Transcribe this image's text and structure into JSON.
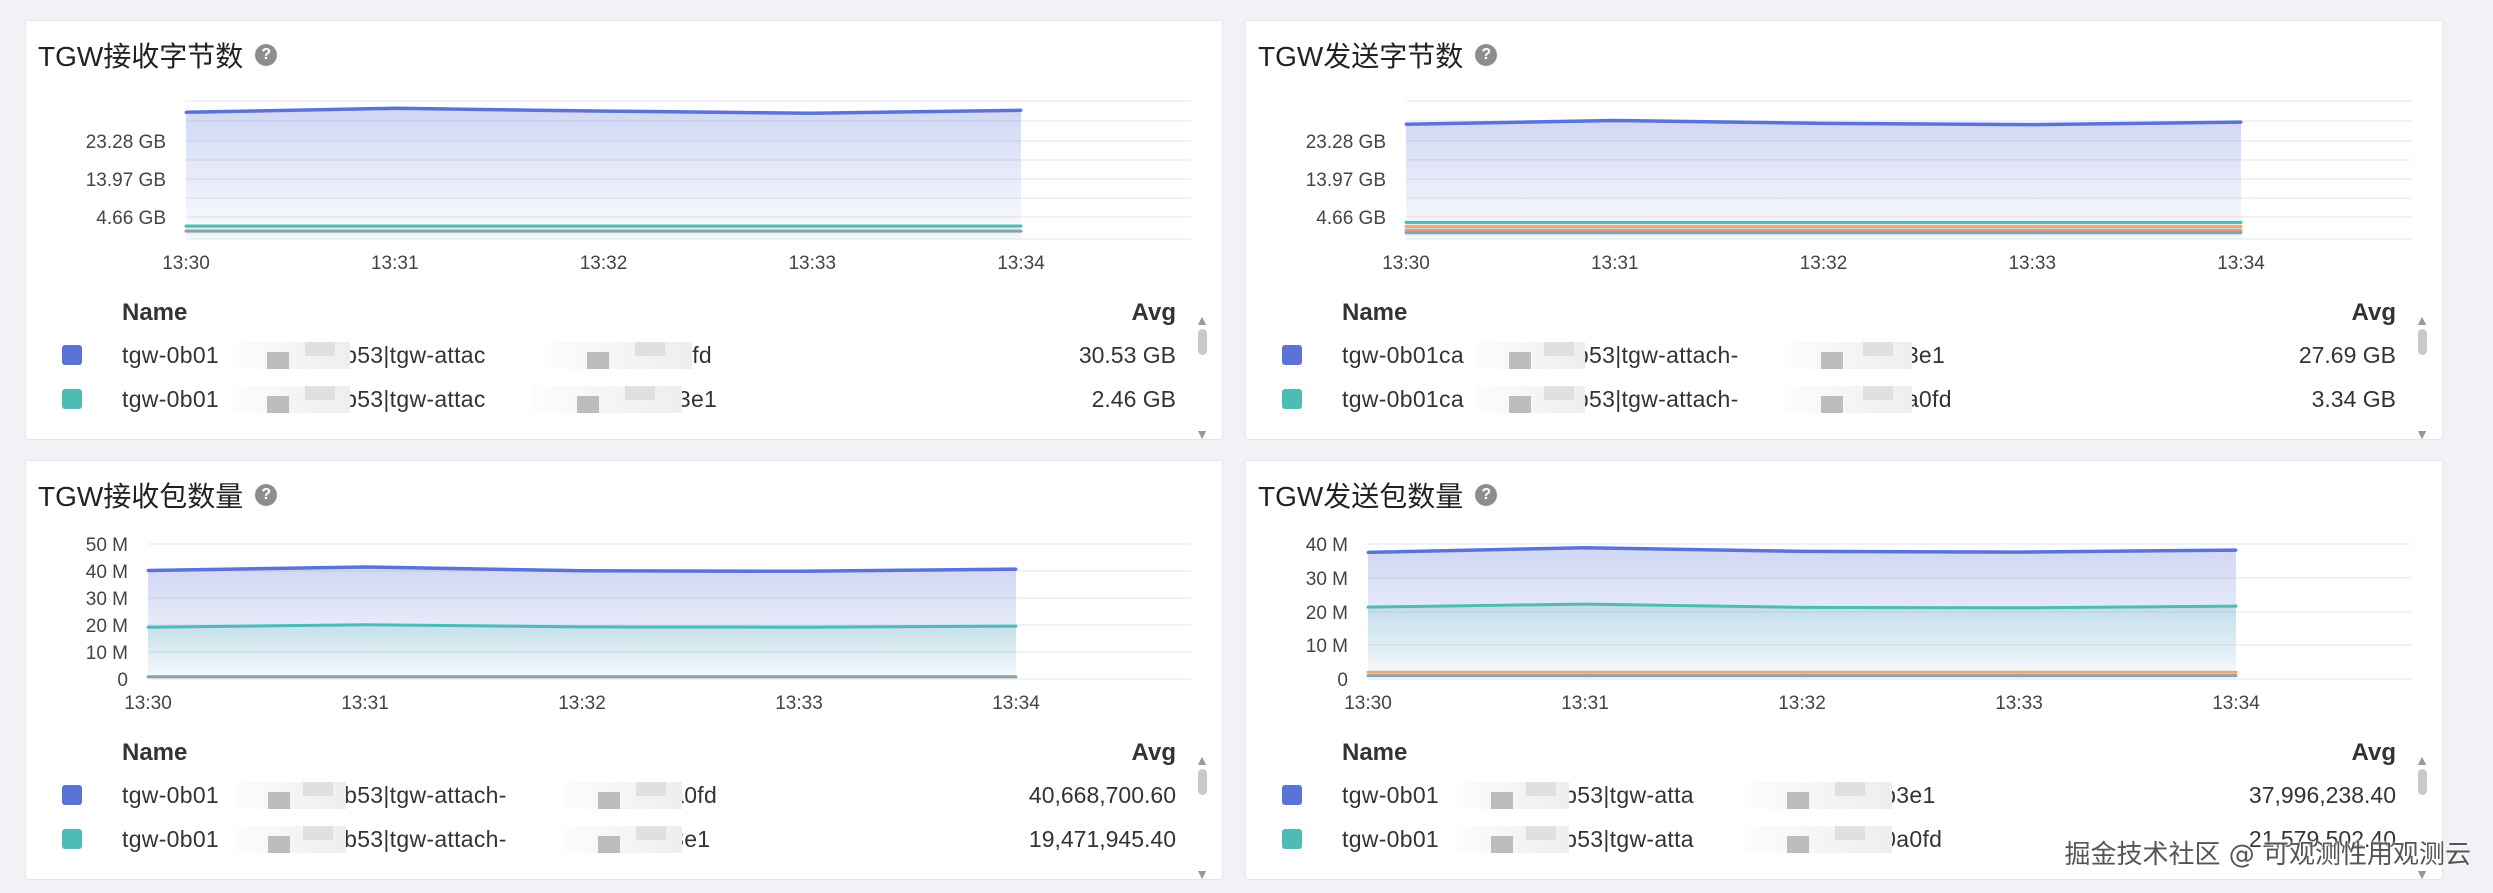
{
  "panels": [
    {
      "title": "TGW接收字节数",
      "y_ticks": [
        "23.28 GB",
        "13.97 GB",
        "4.66 GB"
      ],
      "x_ticks": [
        "13:30",
        "13:31",
        "13:32",
        "13:33",
        "13:34"
      ],
      "legend_header": {
        "name": "Name",
        "avg": "Avg"
      },
      "rows": [
        {
          "name": "tgw-0b01",
          "name_mid": "ab53|tgw-attac",
          "name_end": "8a20a0fd",
          "avg": "30.53 GB",
          "color": "#5b73d8"
        },
        {
          "name": "tgw-0b01",
          "name_mid": "ab53|tgw-attac",
          "name_end": "ca91b3e1",
          "avg": "2.46 GB",
          "color": "#4ebbb4"
        }
      ]
    },
    {
      "title": "TGW发送字节数",
      "y_ticks": [
        "23.28 GB",
        "13.97 GB",
        "4.66 GB"
      ],
      "x_ticks": [
        "13:30",
        "13:31",
        "13:32",
        "13:33",
        "13:34"
      ],
      "legend_header": {
        "name": "Name",
        "avg": "Avg"
      },
      "rows": [
        {
          "name": "tgw-0b01ca",
          "name_mid": "b53|tgw-attach-",
          "name_end": "91b3e1",
          "avg": "27.69 GB",
          "color": "#5b73d8"
        },
        {
          "name": "tgw-0b01ca",
          "name_mid": "b53|tgw-attach-",
          "name_end": "a20a0fd",
          "avg": "3.34 GB",
          "color": "#4ebbb4"
        }
      ]
    },
    {
      "title": "TGW接收包数量",
      "y_ticks": [
        "50 M",
        "40 M",
        "30 M",
        "20 M",
        "10 M",
        "0"
      ],
      "x_ticks": [
        "13:30",
        "13:31",
        "13:32",
        "13:33",
        "13:34"
      ],
      "legend_header": {
        "name": "Name",
        "avg": "Avg"
      },
      "rows": [
        {
          "name": "tgw-0b01",
          "name_mid": "ab53|tgw-attach-",
          "name_end": "8a20a0fd",
          "avg": "40,668,700.60",
          "color": "#5b73d8"
        },
        {
          "name": "tgw-0b01",
          "name_mid": "ab53|tgw-attach-",
          "name_end": "a91b3e1",
          "avg": "19,471,945.40",
          "color": "#4ebbb4"
        }
      ]
    },
    {
      "title": "TGW发送包数量",
      "y_ticks": [
        "40 M",
        "30 M",
        "20 M",
        "10 M",
        "0"
      ],
      "x_ticks": [
        "13:30",
        "13:31",
        "13:32",
        "13:33",
        "13:34"
      ],
      "legend_header": {
        "name": "Name",
        "avg": "Avg"
      },
      "rows": [
        {
          "name": "tgw-0b01",
          "name_mid": "ab53|tgw-atta",
          "name_end": "a91b3e1",
          "avg": "37,996,238.40",
          "color": "#5b73d8"
        },
        {
          "name": "tgw-0b01",
          "name_mid": "ab53|tgw-atta",
          "name_end": "8a20a0fd",
          "avg": "21,579,502.40",
          "color": "#4ebbb4"
        }
      ]
    }
  ],
  "watermark": "掘金技术社区 @ 可观测性用观测云",
  "chart_data": [
    {
      "type": "area",
      "x": [
        "13:30",
        "13:31",
        "13:32",
        "13:33",
        "13:34"
      ],
      "ylim": [
        0,
        30
      ],
      "unit": "GB",
      "series": [
        {
          "values": [
            30.3,
            31.3,
            30.6,
            30.1,
            30.8
          ],
          "color": "#5b73d8"
        },
        {
          "values": [
            2.46,
            2.46,
            2.46,
            2.46,
            2.46
          ],
          "color": "#4ebbb4"
        },
        {
          "values": [
            1.2,
            1.2,
            1.2,
            1.2,
            1.2
          ],
          "color": "#8fa0a8"
        }
      ]
    },
    {
      "type": "area",
      "x": [
        "13:30",
        "13:31",
        "13:32",
        "13:33",
        "13:34"
      ],
      "ylim": [
        0,
        30
      ],
      "unit": "GB",
      "series": [
        {
          "values": [
            27.4,
            28.3,
            27.6,
            27.3,
            27.9
          ],
          "color": "#5b73d8"
        },
        {
          "values": [
            3.34,
            3.34,
            3.34,
            3.34,
            3.34
          ],
          "color": "#4ebbb4"
        },
        {
          "values": [
            2.3,
            2.3,
            2.3,
            2.3,
            2.3
          ],
          "color": "#f0a86a"
        },
        {
          "values": [
            1.4,
            1.4,
            1.4,
            1.4,
            1.4
          ],
          "color": "#d99a9a"
        },
        {
          "values": [
            0.8,
            0.8,
            0.8,
            0.8,
            0.8
          ],
          "color": "#8fa0a8"
        }
      ]
    },
    {
      "type": "area",
      "x": [
        "13:30",
        "13:31",
        "13:32",
        "13:33",
        "13:34"
      ],
      "ylim": [
        0,
        50
      ],
      "unit": "M",
      "series": [
        {
          "values": [
            40.2,
            41.5,
            40.1,
            39.9,
            40.7
          ],
          "color": "#5b73d8"
        },
        {
          "values": [
            19.2,
            20.1,
            19.3,
            19.2,
            19.6
          ],
          "color": "#4ebbb4"
        },
        {
          "values": [
            0.8,
            0.8,
            0.8,
            0.8,
            0.8
          ],
          "color": "#8fa0a8"
        }
      ]
    },
    {
      "type": "area",
      "x": [
        "13:30",
        "13:31",
        "13:32",
        "13:33",
        "13:34"
      ],
      "ylim": [
        0,
        40
      ],
      "unit": "M",
      "series": [
        {
          "values": [
            37.5,
            38.9,
            37.8,
            37.6,
            38.2
          ],
          "color": "#5b73d8"
        },
        {
          "values": [
            21.3,
            22.2,
            21.2,
            21.1,
            21.6
          ],
          "color": "#4ebbb4"
        },
        {
          "values": [
            2.0,
            2.0,
            2.0,
            2.0,
            2.0
          ],
          "color": "#f0a86a"
        },
        {
          "values": [
            1.0,
            1.0,
            1.0,
            1.0,
            1.0
          ],
          "color": "#8fa0a8"
        }
      ]
    }
  ]
}
